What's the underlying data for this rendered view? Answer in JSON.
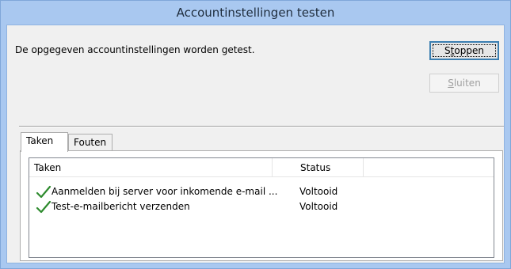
{
  "window": {
    "title": "Accountinstellingen testen"
  },
  "message": "De opgegeven accountinstellingen worden getest.",
  "buttons": {
    "stop": {
      "prefix": "S",
      "underline": "t",
      "rest": "oppen"
    },
    "close": {
      "underline": "S",
      "rest": "luiten"
    }
  },
  "tabs": [
    {
      "label": "Taken",
      "active": true
    },
    {
      "label": "Fouten",
      "active": false
    }
  ],
  "task_list": {
    "columns": [
      "Taken",
      "Status"
    ],
    "rows": [
      {
        "task": "Aanmelden bij server voor inkomende e-mail ...",
        "status": "Voltooid",
        "icon": "check-icon"
      },
      {
        "task": "Test-e-mailbericht verzenden",
        "status": "Voltooid",
        "icon": "check-icon"
      }
    ]
  },
  "colors": {
    "title_bar": "#a9c8f0",
    "check": "#2e8b2e"
  }
}
